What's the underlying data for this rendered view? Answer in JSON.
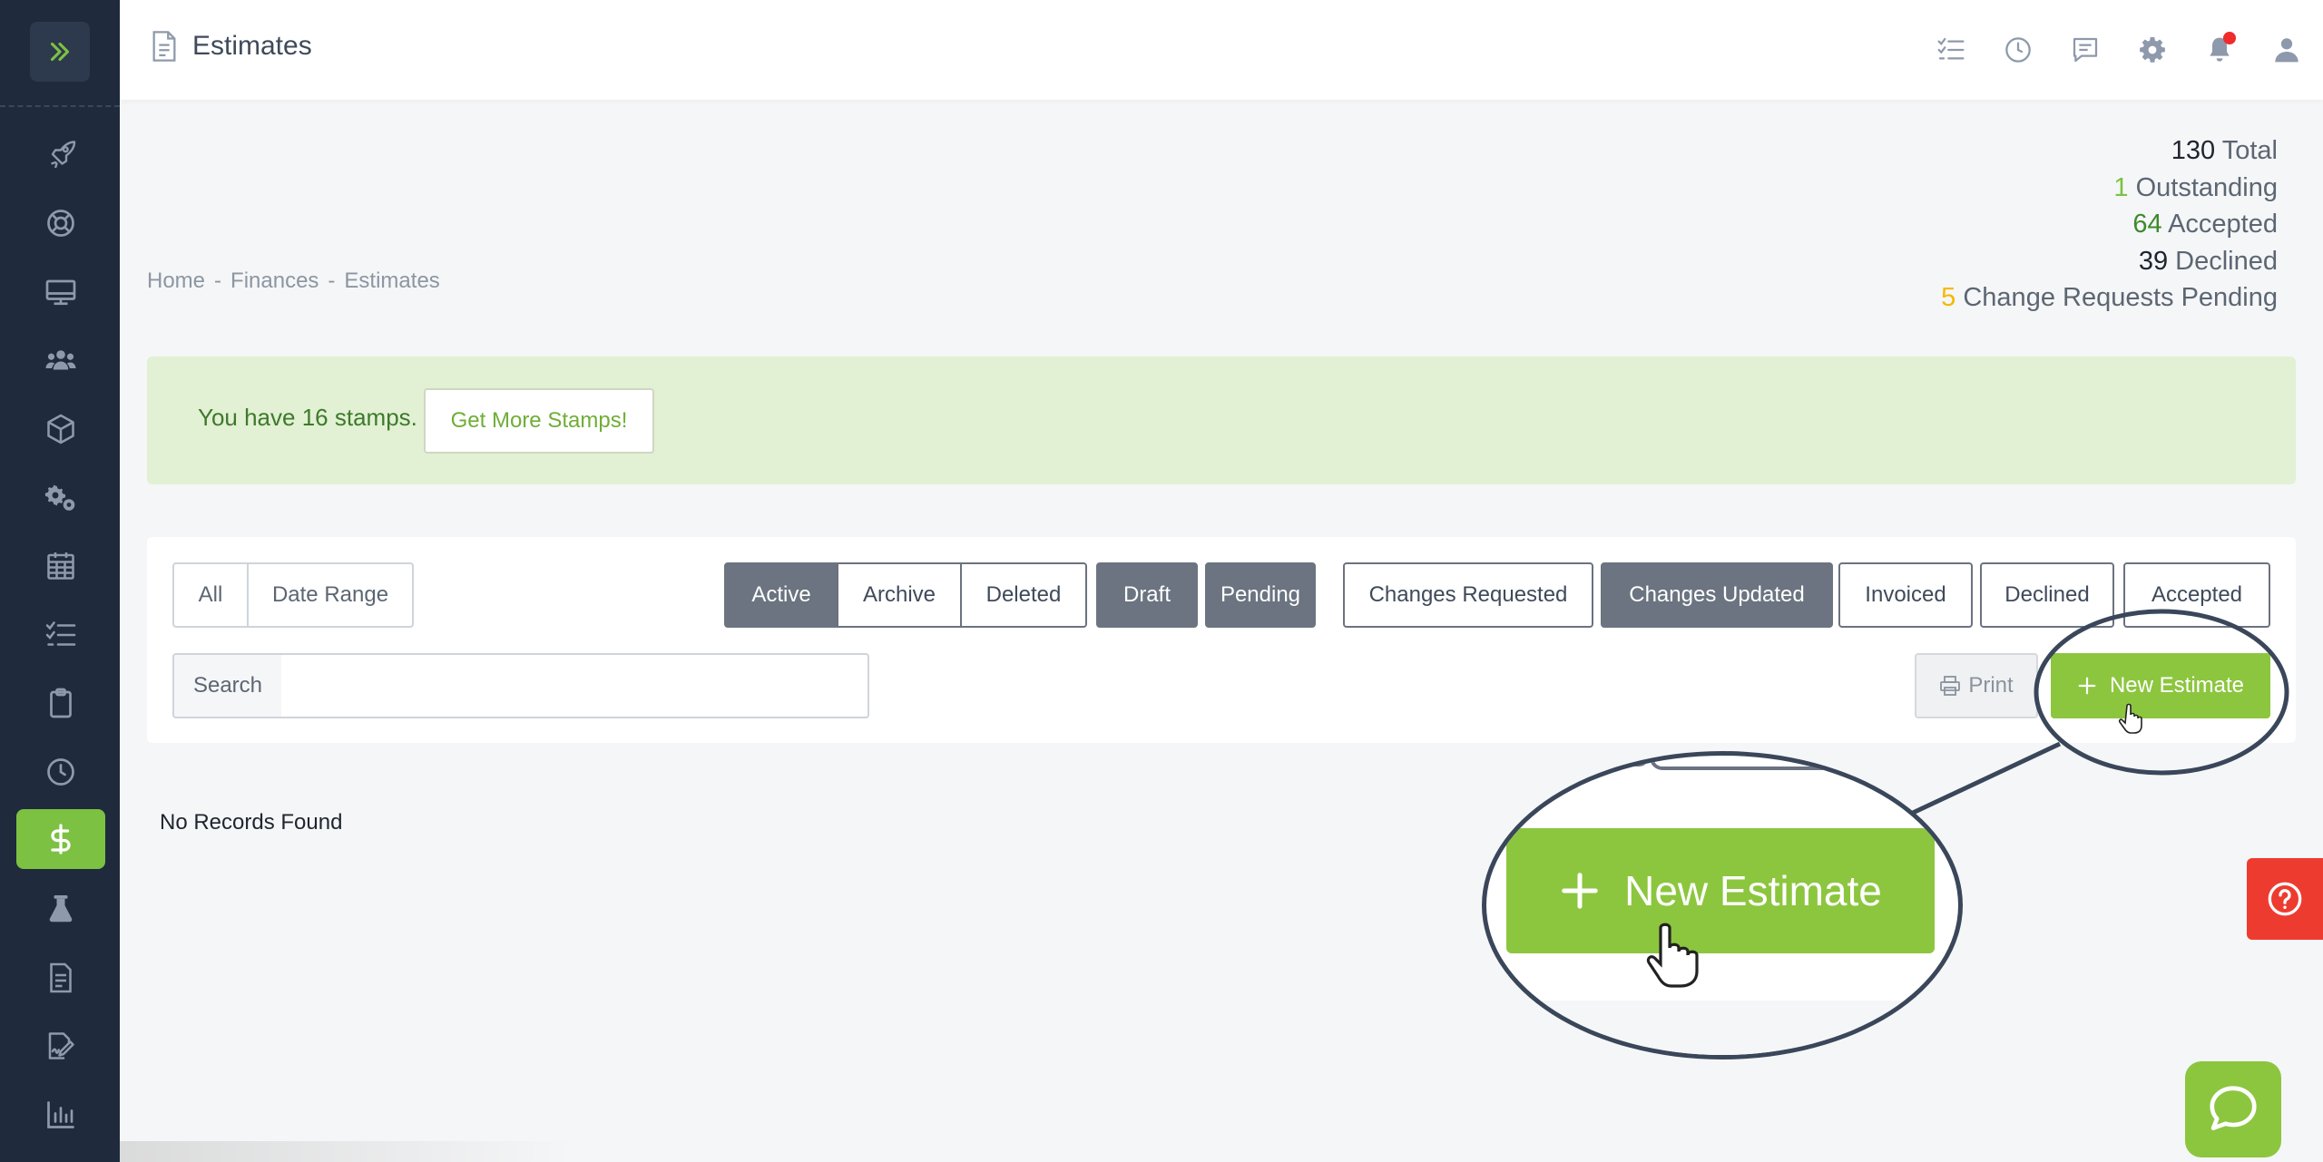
{
  "page": {
    "title": "Estimates"
  },
  "sidebar": {
    "items": [
      {
        "icon": "rocket-icon"
      },
      {
        "icon": "lifebuoy-icon"
      },
      {
        "icon": "monitor-icon"
      },
      {
        "icon": "users-icon"
      },
      {
        "icon": "box-icon"
      },
      {
        "icon": "gears-icon"
      },
      {
        "icon": "calendar-icon"
      },
      {
        "icon": "checklist-icon"
      },
      {
        "icon": "clipboard-icon"
      },
      {
        "icon": "clock-icon"
      },
      {
        "icon": "dollar-icon"
      },
      {
        "icon": "flask-icon"
      },
      {
        "icon": "document-icon"
      },
      {
        "icon": "signature-icon"
      },
      {
        "icon": "bar-chart-icon"
      }
    ],
    "active_index": 10,
    "active_color": "#7cc142"
  },
  "topbar": {
    "icons": [
      "checklist-icon",
      "clock-icon",
      "chat-icon",
      "gear-icon",
      "bell-icon",
      "user-icon"
    ]
  },
  "breadcrumb": {
    "home": "Home",
    "sep": "-",
    "finances": "Finances",
    "current": "Estimates"
  },
  "stats": {
    "total_num": "130",
    "total_label": "Total",
    "outstanding_num": "1",
    "outstanding_label": "Outstanding",
    "accepted_num": "64",
    "accepted_label": "Accepted",
    "declined_num": "39",
    "declined_label": "Declined",
    "changes_num": "5",
    "changes_label": "Change Requests Pending"
  },
  "stamps": {
    "text": "You have 16 stamps.",
    "button": "Get More Stamps!"
  },
  "filters": {
    "all": "All",
    "date_range": "Date Range",
    "active": "Active",
    "archive": "Archive",
    "deleted": "Deleted",
    "draft": "Draft",
    "pending": "Pending",
    "changes_requested": "Changes Requested",
    "changes_updated": "Changes Updated",
    "invoiced": "Invoiced",
    "declined": "Declined",
    "accepted": "Accepted"
  },
  "search": {
    "label": "Search",
    "value": "",
    "placeholder": ""
  },
  "actions": {
    "print": "Print",
    "new_estimate": "New Estimate"
  },
  "list": {
    "empty": "No Records Found"
  },
  "zoom": {
    "label": "New Estimate"
  },
  "colors": {
    "sidebar": "#1f2a3d",
    "accent": "#8cc63f",
    "help": "#ee3b2f"
  }
}
